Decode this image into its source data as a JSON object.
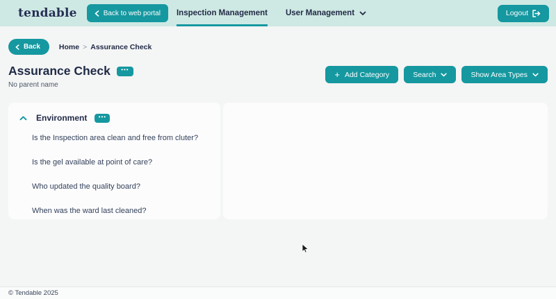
{
  "header": {
    "logo": "tendable",
    "back_to_portal_label": "Back to web portal",
    "tabs": [
      {
        "label": "Inspection Management",
        "active": true
      },
      {
        "label": "User Management",
        "active": false
      }
    ],
    "logout_label": "Logout"
  },
  "breadcrumb_bar": {
    "back_label": "Back",
    "items": [
      "Home",
      "Assurance Check"
    ],
    "separator": ">"
  },
  "page": {
    "title": "Assurance Check",
    "subtitle": "No parent name",
    "actions": [
      {
        "label": "Add Category",
        "icon": "plus-icon"
      },
      {
        "label": "Search",
        "icon": "chevron-down-icon"
      },
      {
        "label": "Show Area Types",
        "icon": "chevron-down-icon"
      }
    ]
  },
  "category": {
    "name": "Environment",
    "questions": [
      "Is the Inspection area clean and free from cluter?",
      "Is the gel available at point of care?",
      "Who updated the quality board?",
      "When was the ward last cleaned?"
    ]
  },
  "footer": {
    "copyright": "© Tendable 2025"
  },
  "colors": {
    "teal_accent": "#1598a0",
    "header_background": "#cee9e3",
    "navy_text": "#222b47",
    "page_background": "#f4f5f5",
    "card_background": "#fcfcfd"
  }
}
